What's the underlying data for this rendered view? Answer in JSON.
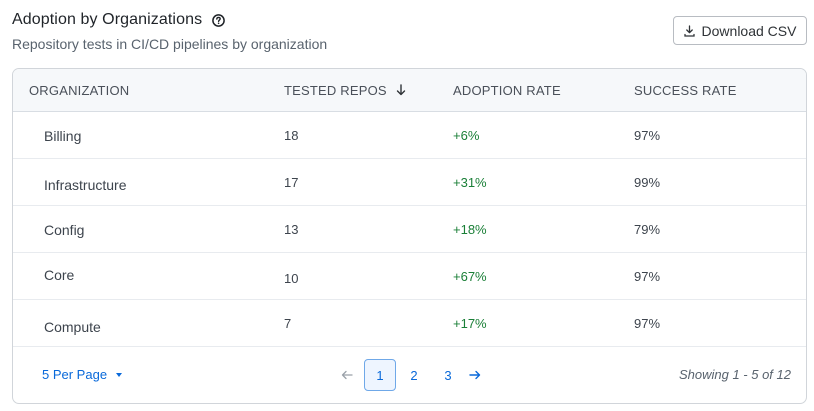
{
  "header": {
    "title": "Adoption by Organizations",
    "subtitle": "Repository tests in CI/CD pipelines by organization",
    "download_label": "Download CSV"
  },
  "table": {
    "columns": [
      "ORGANIZATION",
      "TESTED REPOS",
      "ADOPTION RATE",
      "SUCCESS RATE"
    ],
    "sort_column": "TESTED REPOS",
    "sort_direction": "descending",
    "rows": [
      {
        "organization": "Billing",
        "tested_repos": "18",
        "adoption_rate": "+6%",
        "success_rate": "97%"
      },
      {
        "organization": "Infrastructure",
        "tested_repos": "17",
        "adoption_rate": "+31%",
        "success_rate": "99%"
      },
      {
        "organization": "Config",
        "tested_repos": "13",
        "adoption_rate": "+18%",
        "success_rate": "79%"
      },
      {
        "organization": "Core",
        "tested_repos": "10",
        "adoption_rate": "+67%",
        "success_rate": "97%"
      },
      {
        "organization": "Compute",
        "tested_repos": "7",
        "adoption_rate": "+17%",
        "success_rate": "97%"
      }
    ]
  },
  "pagination": {
    "per_page_label": "5 Per Page",
    "pages": [
      "1",
      "2",
      "3"
    ],
    "current_page": "1",
    "showing_text": "Showing 1 - 5 of 12"
  },
  "colors": {
    "accent": "#0969da",
    "positive": "#1a7f37",
    "header_bg": "#f6f8fa",
    "border": "#d1d5da"
  },
  "icons": {
    "help": "question-circle-icon",
    "download": "download-icon",
    "sort": "arrow-down-icon",
    "prev": "arrow-left-icon",
    "next": "arrow-right-icon",
    "dropdown": "caret-down-icon"
  }
}
